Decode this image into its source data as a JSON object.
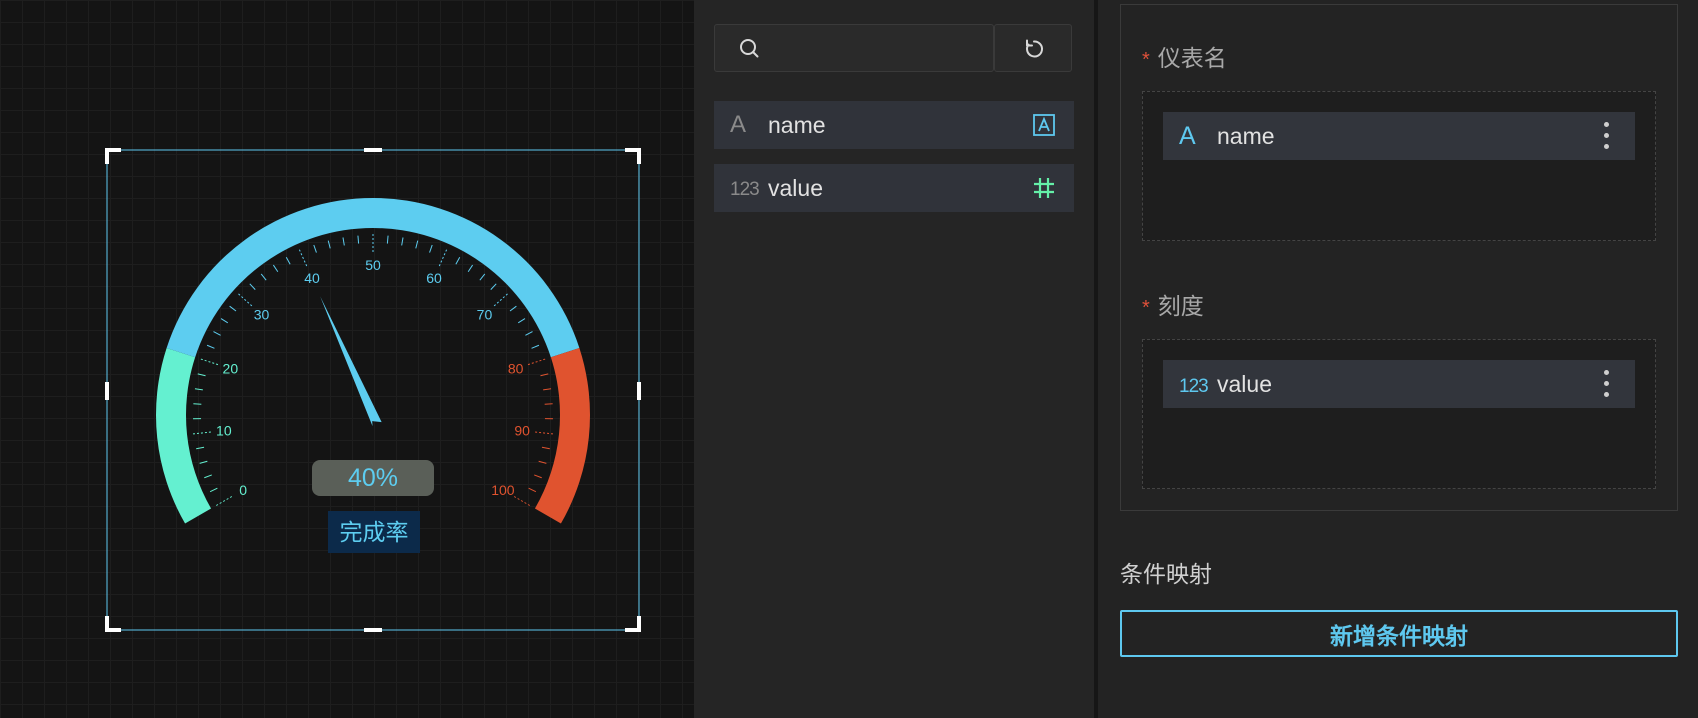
{
  "gauge": {
    "value": 40,
    "value_text": "40%",
    "name": "完成率",
    "ticks": [
      "0",
      "10",
      "20",
      "30",
      "40",
      "50",
      "60",
      "70",
      "80",
      "90",
      "100"
    ],
    "colors": {
      "low": "#64f0d0",
      "mid": "#5dcdf0",
      "high": "#e0532f",
      "value_bg": "#5a5f58",
      "name_bg": "#0c2a4a",
      "selection": "#5ec8ef"
    }
  },
  "field_panel": {
    "search_placeholder": "",
    "fields": [
      {
        "icon": "A",
        "name": "name",
        "type_icon": "text-type-icon"
      },
      {
        "icon": "123",
        "name": "value",
        "type_icon": "number-type-icon"
      }
    ]
  },
  "config": {
    "sections": [
      {
        "required_mark": "*",
        "label": "仪表名",
        "chip_icon": "A",
        "chip_name": "name"
      },
      {
        "required_mark": "*",
        "label": "刻度",
        "chip_icon": "123",
        "chip_name": "value"
      }
    ],
    "condition_title": "条件映射",
    "add_condition_label": "新增条件映射"
  }
}
